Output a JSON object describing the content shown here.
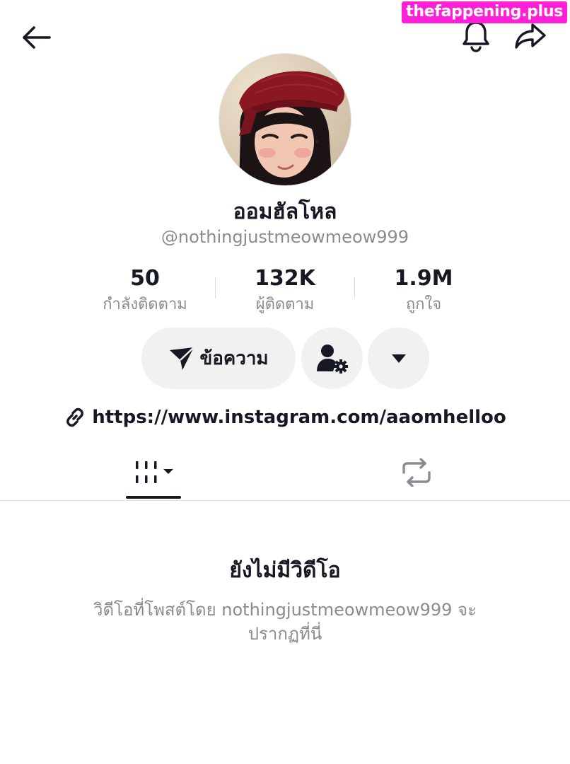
{
  "watermark": "thefappening.plus",
  "header": {
    "back_icon": "arrow-left-icon",
    "bell_icon": "bell-icon",
    "share_icon": "share-icon"
  },
  "profile": {
    "display_name": "ออมฮัลโหล",
    "username": "@nothingjustmeowmeow999"
  },
  "stats": [
    {
      "value": "50",
      "label": "กำลังติดตาม"
    },
    {
      "value": "132K",
      "label": "ผู้ติดตาม"
    },
    {
      "value": "1.9M",
      "label": "ถูกใจ"
    }
  ],
  "actions": {
    "message_label": "ข้อความ",
    "message_icon": "send-icon",
    "add_friend_icon": "user-settings-icon",
    "more_icon": "caret-down-icon"
  },
  "bio": {
    "link_icon": "link-icon",
    "link": "https://www.instagram.com/aaomhelloo"
  },
  "tabs": {
    "videos_icon": "grid-icon",
    "reposts_icon": "repost-icon"
  },
  "empty_state": {
    "title": "ยังไม่มีวิดีโอ",
    "description": "วิดีโอที่โพสต์โดย nothingjustmeowmeow999 จะปรากฏที่นี่"
  },
  "colors": {
    "text_primary": "#161823",
    "text_secondary": "#8a8b91",
    "button_bg": "#f1f1f2",
    "watermark_bg": "#ff1fd6"
  }
}
